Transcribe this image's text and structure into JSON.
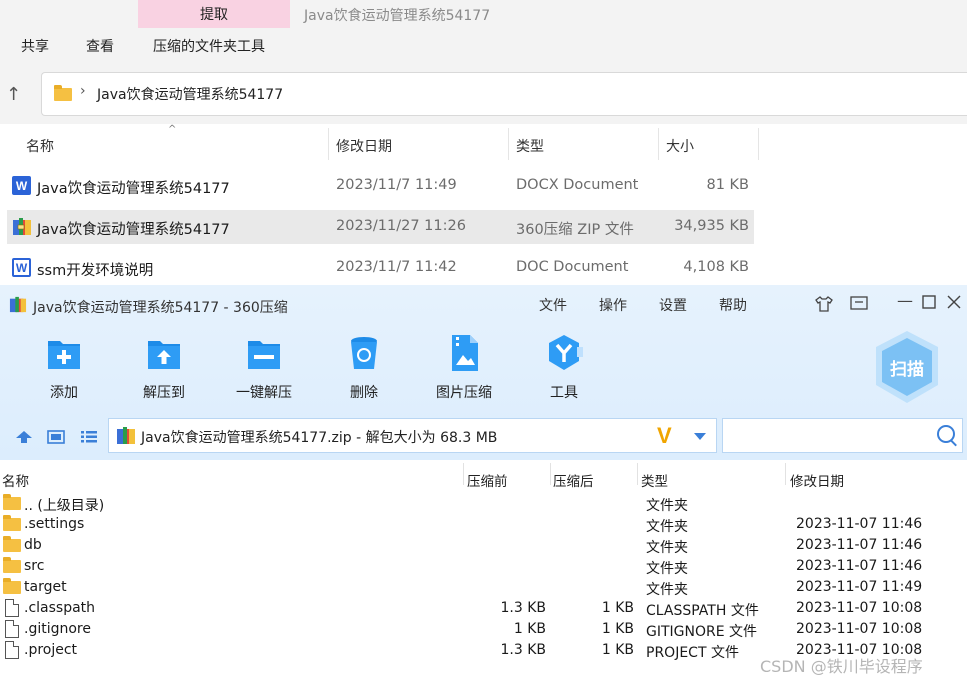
{
  "explorer": {
    "context_tab": "提取",
    "window_title": "Java饮食运动管理系统54177",
    "ribbon_tabs": [
      "共享",
      "查看",
      "压缩的文件夹工具"
    ],
    "address": "Java饮食运动管理系统54177",
    "columns": [
      "名称",
      "修改日期",
      "类型",
      "大小"
    ],
    "files": [
      {
        "name": "Java饮食运动管理系统54177",
        "date": "2023/11/7 11:49",
        "type": "DOCX Document",
        "size": "81 KB",
        "icon": "word-doc-icon"
      },
      {
        "name": "Java饮食运动管理系统54177",
        "date": "2023/11/27 11:26",
        "type": "360压缩 ZIP 文件",
        "size": "34,935 KB",
        "icon": "zip-archive-icon"
      },
      {
        "name": "ssm开发环境说明",
        "date": "2023/11/7 11:42",
        "type": "DOC Document",
        "size": "4,108 KB",
        "icon": "word-doc-icon"
      }
    ]
  },
  "zip": {
    "window_title": "Java饮食运动管理系统54177 - 360压缩",
    "menu": [
      "文件",
      "操作",
      "设置",
      "帮助"
    ],
    "tools": [
      {
        "label": "添加",
        "icon": "add-icon"
      },
      {
        "label": "解压到",
        "icon": "extract-to-icon"
      },
      {
        "label": "一键解压",
        "icon": "one-click-extract-icon"
      },
      {
        "label": "删除",
        "icon": "delete-icon"
      },
      {
        "label": "图片压缩",
        "icon": "image-compress-icon"
      },
      {
        "label": "工具",
        "icon": "tools-icon"
      }
    ],
    "scan_label": "扫描",
    "path": "Java饮食运动管理系统54177.zip - 解包大小为 68.3 MB",
    "columns": [
      "名称",
      "压缩前",
      "压缩后",
      "类型",
      "修改日期"
    ],
    "rows": [
      {
        "name": ".. (上级目录)",
        "before": "",
        "after": "",
        "type": "文件夹",
        "date": "",
        "kind": "folder"
      },
      {
        "name": ".settings",
        "before": "",
        "after": "",
        "type": "文件夹",
        "date": "2023-11-07 11:46",
        "kind": "folder"
      },
      {
        "name": "db",
        "before": "",
        "after": "",
        "type": "文件夹",
        "date": "2023-11-07 11:46",
        "kind": "folder"
      },
      {
        "name": "src",
        "before": "",
        "after": "",
        "type": "文件夹",
        "date": "2023-11-07 11:46",
        "kind": "folder"
      },
      {
        "name": "target",
        "before": "",
        "after": "",
        "type": "文件夹",
        "date": "2023-11-07 11:49",
        "kind": "folder"
      },
      {
        "name": ".classpath",
        "before": "1.3 KB",
        "after": "1 KB",
        "type": "CLASSPATH 文件",
        "date": "2023-11-07 10:08",
        "kind": "file"
      },
      {
        "name": ".gitignore",
        "before": "1 KB",
        "after": "1 KB",
        "type": "GITIGNORE 文件",
        "date": "2023-11-07 10:08",
        "kind": "file"
      },
      {
        "name": ".project",
        "before": "1.3 KB",
        "after": "1 KB",
        "type": "PROJECT 文件",
        "date": "2023-11-07 10:08",
        "kind": "file"
      }
    ]
  },
  "watermark": "CSDN @铁川毕设程序"
}
